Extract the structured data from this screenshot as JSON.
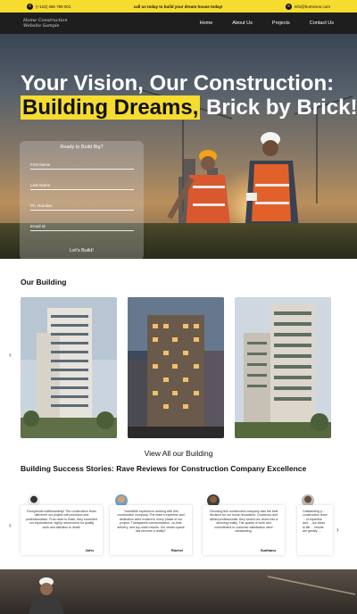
{
  "topbar": {
    "phone": "(+123) 456 789 001",
    "promo": "call us today to build your dream house today!",
    "email": "info@homeson.com"
  },
  "nav": {
    "logo_line1": "Home Construction",
    "logo_line2": "Website Sample",
    "links": [
      "Home",
      "About Us",
      "Projects",
      "Contact Us"
    ]
  },
  "hero": {
    "title_line1": "Your Vision, Our Construction:",
    "title_highlight": "Building Dreams,",
    "title_rest": "Brick by Brick!"
  },
  "form": {
    "title": "Ready to Build Big?",
    "first_name": "First Name",
    "last_name": "Last Name",
    "phone": "Ph. Number",
    "email": "Email Id",
    "submit": "Let's Build!"
  },
  "buildings": {
    "title": "Our Building",
    "view_all": "View All our Building",
    "prev_arrow": "‹"
  },
  "stories": {
    "title": "Building Success Stories: Rave Reviews for Construction Company Excellence",
    "prev_arrow": "‹",
    "next_arrow": "›",
    "items": [
      {
        "text": "Exceptional craftsmanship! The construction team delivered our project with precision and professionalism. From start to finish, they exceeded our expectations; highly recommend for quality work and attention to detail.",
        "name": "John"
      },
      {
        "text": "\"Incredible experience working with this construction company! The team's expertise and dedication were evident in every phase of our project. Transparent communication, on-time delivery, and top-notch results. Our dream space has become a reality!\"",
        "name": "Rachel"
      },
      {
        "text": "Choosing this construction company was the best decision for our home renovation. Courteous and skilled professionals, they turned our vision into a stunning reality. The quality of work and commitment to customer satisfaction were outstanding.",
        "name": "Sudhanu"
      },
      {
        "text": "Outstanding p... construction team ... of expertise and ... our ideas to life ... results are greatly ...",
        "name": ""
      }
    ]
  },
  "colors": {
    "accent": "#f5dc2e",
    "nav_bg": "#1e1e1e"
  }
}
